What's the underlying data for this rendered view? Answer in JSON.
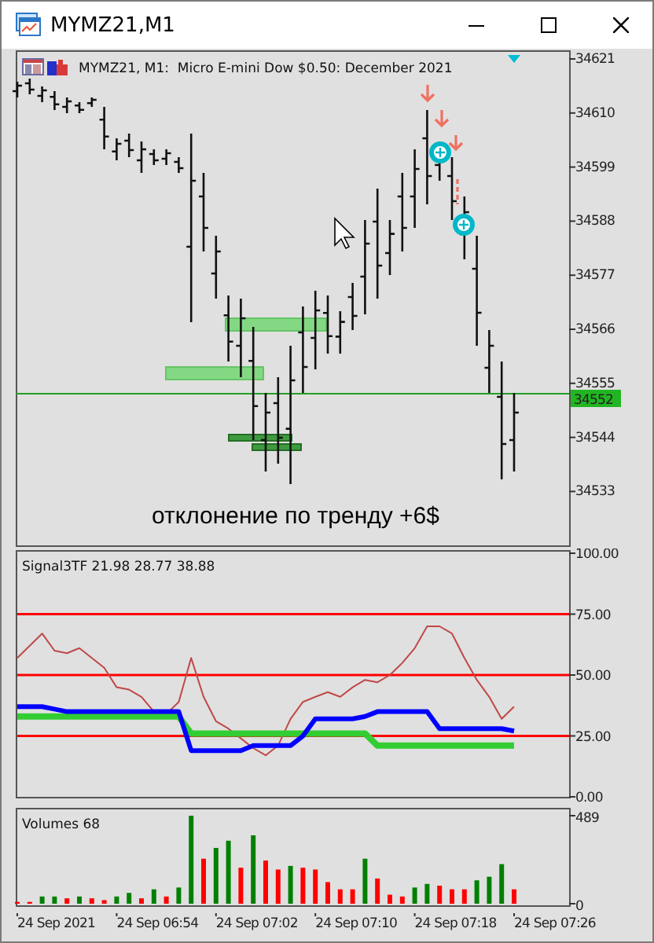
{
  "window": {
    "title": "MYMZ21,M1"
  },
  "main_chart": {
    "header": "MYMZ21, M1:  Micro E-mini Dow $0.50: December 2021",
    "price_labels": [
      "34621",
      "34610",
      "34599",
      "34588",
      "34577",
      "34566",
      "34555",
      "34544",
      "34533"
    ],
    "current_price": "34552",
    "caption": "отклонение по тренду +6$"
  },
  "indicator": {
    "chart_data": {
      "type": "line",
      "title": "Signal3TF 21.98 28.77 38.88",
      "ylim": [
        0,
        100
      ],
      "grid": true,
      "yticks": [
        {
          "value": 100,
          "label": "100.00"
        },
        {
          "value": 75,
          "label": "75.00"
        },
        {
          "value": 50,
          "label": "50.00"
        },
        {
          "value": 25,
          "label": "25.00"
        },
        {
          "value": 0,
          "label": "0.00"
        }
      ],
      "series": [
        {
          "color": "#c04848",
          "values": [
            57,
            62,
            67,
            60,
            59,
            61,
            57,
            53,
            45,
            44,
            41,
            35,
            34,
            39,
            57,
            41,
            31,
            28,
            24,
            20,
            17,
            21,
            32,
            39,
            41,
            43,
            41,
            45,
            48,
            47,
            50,
            55,
            61,
            70,
            70,
            67,
            57,
            48,
            41,
            32,
            37
          ]
        },
        {
          "color": "#32cd32",
          "values": [
            33,
            33,
            33,
            33,
            33,
            33,
            33,
            33,
            33,
            33,
            33,
            33,
            33,
            33,
            26,
            26,
            26,
            26,
            26,
            26,
            26,
            26,
            26,
            26,
            26,
            26,
            26,
            26,
            26,
            21,
            21,
            21,
            21,
            21,
            21,
            21,
            21,
            21,
            21,
            21,
            21
          ]
        },
        {
          "color": "#0000ff",
          "values": [
            37,
            37,
            37,
            36,
            35,
            35,
            35,
            35,
            35,
            35,
            35,
            35,
            35,
            35,
            19,
            19,
            19,
            19,
            19,
            21,
            21,
            21,
            21,
            25,
            32,
            32,
            32,
            32,
            33,
            35,
            35,
            35,
            35,
            35,
            28,
            28,
            28,
            28,
            28,
            28,
            27
          ]
        }
      ]
    }
  },
  "volumes": {
    "chart_data": {
      "type": "bar",
      "title": "Volumes 68",
      "ylim": [
        0,
        489
      ],
      "yticks": [
        489,
        0
      ],
      "series": [
        {
          "color": "#008000",
          "values": [
            null,
            null,
            40,
            40,
            null,
            40,
            null,
            null,
            40,
            60,
            null,
            80,
            null,
            90,
            489,
            null,
            310,
            350,
            null,
            380,
            null,
            null,
            210,
            null,
            null,
            null,
            null,
            null,
            250,
            null,
            null,
            null,
            90,
            110,
            null,
            null,
            null,
            130,
            150,
            220,
            null
          ]
        },
        {
          "color": "#ff0000",
          "values": [
            10,
            10,
            null,
            null,
            30,
            null,
            30,
            20,
            null,
            null,
            30,
            null,
            40,
            null,
            null,
            250,
            null,
            null,
            200,
            null,
            240,
            190,
            null,
            200,
            190,
            120,
            80,
            80,
            null,
            140,
            50,
            40,
            null,
            null,
            100,
            80,
            80,
            null,
            null,
            null,
            80
          ]
        }
      ]
    }
  },
  "time_axis": [
    "24 Sep 2021",
    "24 Sep 06:54",
    "24 Sep 07:02",
    "24 Sep 07:10",
    "24 Sep 07:18",
    "24 Sep 07:26"
  ]
}
